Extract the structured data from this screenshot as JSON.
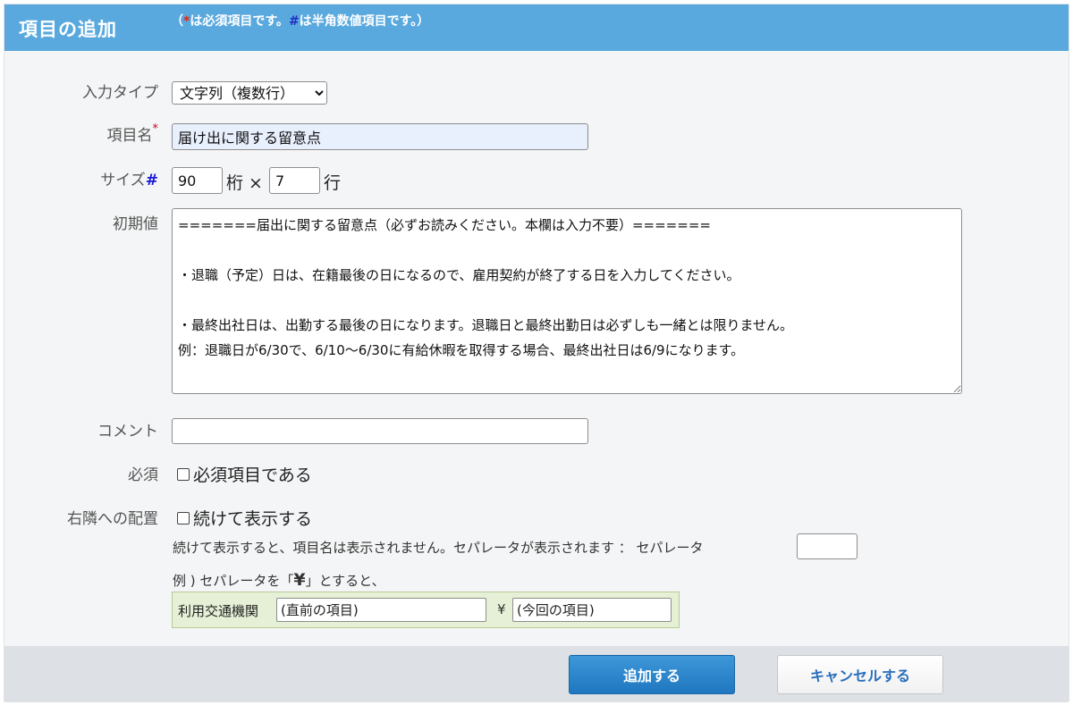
{
  "header": {
    "title": "項目の追加",
    "note_open": "（",
    "note_req_mark": "*",
    "note_req_text": "は必須項目です。",
    "note_num_mark": "#",
    "note_num_text": "は半角数値項目です。）"
  },
  "form": {
    "input_type": {
      "label": "入力タイプ",
      "selected": "文字列（複数行）"
    },
    "item_name": {
      "label": "項目名",
      "req_mark": "*",
      "value": "届け出に関する留意点"
    },
    "size": {
      "label": "サイズ",
      "num_mark": "#",
      "cols_value": "90",
      "cols_unit": "桁 ×",
      "rows_value": "7",
      "rows_unit": "行"
    },
    "initial_value": {
      "label": "初期値",
      "value": "=======届出に関する留意点（必ずお読みください。本欄は入力不要）=======\n\n・退職（予定）日は、在籍最後の日になるので、雇用契約が終了する日を入力してください。\n\n・最終出社日は、出勤する最後の日になります。退職日と最終出勤日は必ずしも一緒とは限りません。\n例：退職日が6/30で、6/10〜6/30に有給休暇を取得する場合、最終出社日は6/9になります。"
    },
    "comment": {
      "label": "コメント",
      "value": ""
    },
    "required": {
      "label": "必須",
      "checkbox_label": "必須項目である"
    },
    "placement": {
      "label": "右隣への配置",
      "checkbox_label": "続けて表示する",
      "description": "続けて表示すると、項目名は表示されません。セパレータが表示されます ： セパレータ",
      "separator_value": "",
      "example_prefix": "例 ) セパレータを「",
      "example_yen": "¥",
      "example_suffix": "」とすると、",
      "example_label": "利用交通機関",
      "example_prev": "(直前の項目)",
      "example_sep": "¥",
      "example_current": "(今回の項目)"
    }
  },
  "footer": {
    "add_label": "追加する",
    "cancel_label": "キャンセルする"
  }
}
